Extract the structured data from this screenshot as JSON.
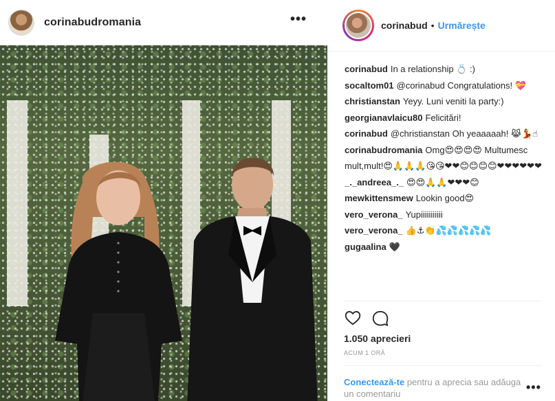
{
  "post_header": {
    "username": "corinabudromania",
    "more_label": "•••"
  },
  "photo": {
    "alt": "Couple posing in front of a floral wall"
  },
  "sidebar_header": {
    "username": "corinabud",
    "separator": "•",
    "follow_label": "Urmărește"
  },
  "comments": [
    {
      "user": "corinabud",
      "text": "In a relationship 💍 :)"
    },
    {
      "user": "socaltom01",
      "text": "@corinabud Congratulations! 💝"
    },
    {
      "user": "christianstan",
      "text": "Yeyy. Luni veniti la party:)"
    },
    {
      "user": "georgianavlaicu80",
      "text": "Felicitări!"
    },
    {
      "user": "corinabud",
      "text": "@christianstan Oh yeaaaaah! 😹💃☝"
    },
    {
      "user": "corinabudromania",
      "text": "Omg😍😍😍😍 Multumesc mult,mult!😍🙏🙏🙏😘😘❤❤😊😊😊😊❤❤❤❤❤❤"
    },
    {
      "user": "_._andreea_._",
      "text": "😍😍🙏🙏❤❤❤😊"
    },
    {
      "user": "mewkittensmew",
      "text": "Lookin good😍"
    },
    {
      "user": "vero_verona_",
      "text": "Yupiiiiiiiiiii"
    },
    {
      "user": "vero_verona_",
      "text": "👍⚓👏💦💦💦💦💦"
    },
    {
      "user": "gugaalina",
      "text": "🖤"
    }
  ],
  "actions": {
    "like_icon": "heart-outline-icon",
    "comment_icon": "speech-bubble-icon"
  },
  "likes_text": "1.050 aprecieri",
  "timestamp": "ACUM 1 ORĂ",
  "login_prompt": {
    "link": "Conectează-te",
    "rest": " pentru a aprecia sau adăuga un comentariu"
  },
  "footer_more_label": "•••",
  "colors": {
    "link_blue": "#3897f0",
    "text": "#262626",
    "muted": "#999999",
    "divider": "#efefef"
  }
}
